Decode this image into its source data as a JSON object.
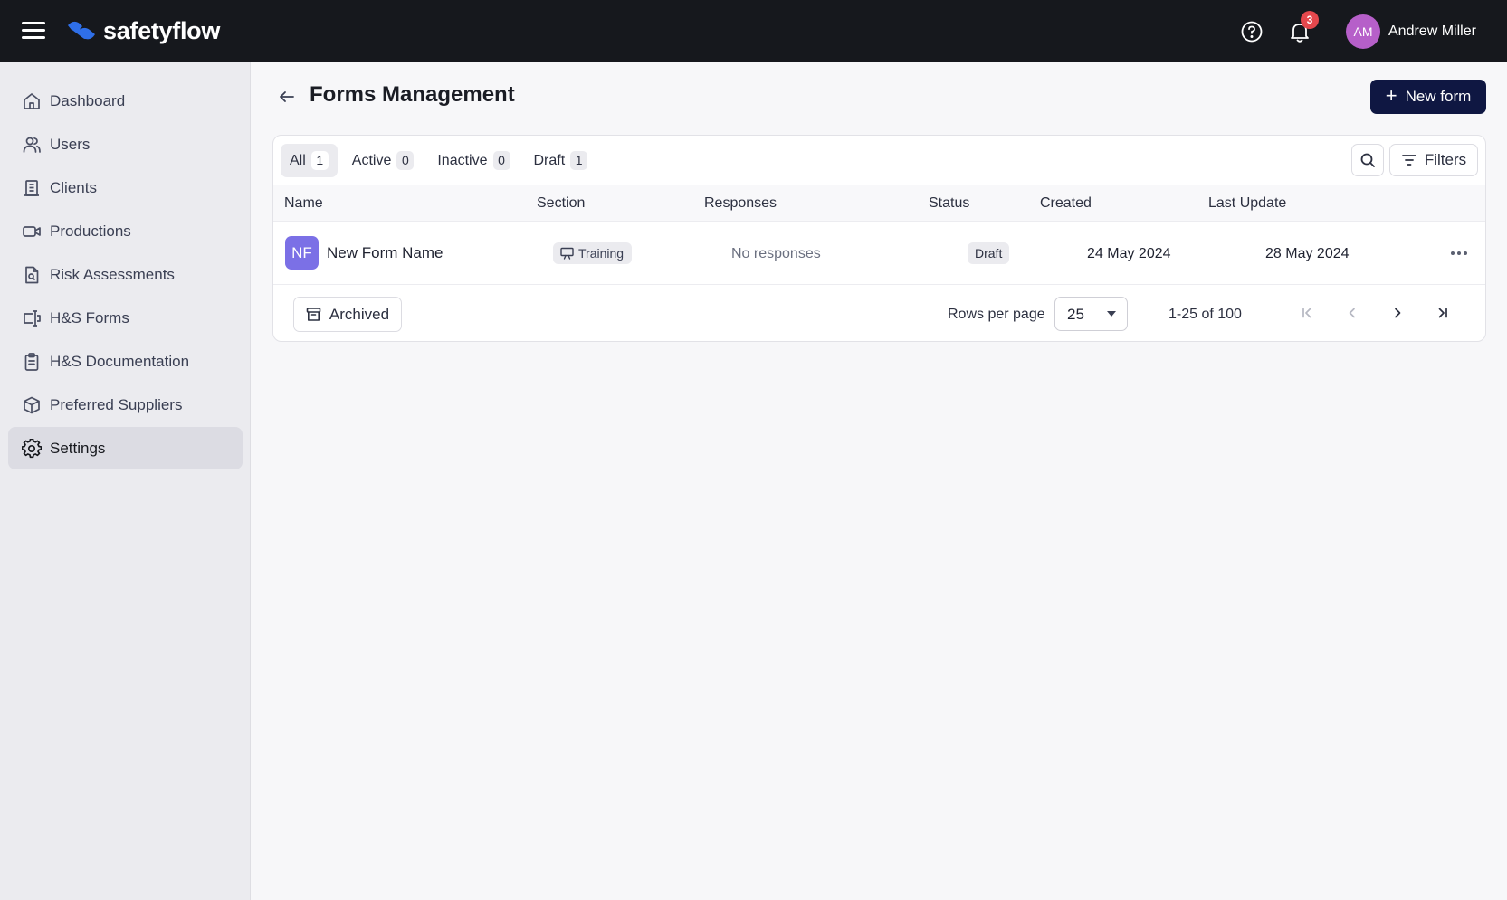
{
  "app": {
    "name": "safetyflow",
    "accent": "#0f1742",
    "brand": "#2f6fe8"
  },
  "topbar": {
    "menu_icon": "hamburger-icon",
    "help_icon": "help-circle-icon",
    "notifications_icon": "bell-icon",
    "notifications_count": "3",
    "user": {
      "initials": "AM",
      "name": "Andrew Miller"
    }
  },
  "sidebar": {
    "items": [
      {
        "label": "Dashboard",
        "icon": "home-icon"
      },
      {
        "label": "Users",
        "icon": "users-icon"
      },
      {
        "label": "Clients",
        "icon": "building-icon"
      },
      {
        "label": "Productions",
        "icon": "video-icon"
      },
      {
        "label": "Risk Assessments",
        "icon": "file-search-icon"
      },
      {
        "label": "H&S Forms",
        "icon": "form-icon"
      },
      {
        "label": "H&S Documentation",
        "icon": "clipboard-icon"
      },
      {
        "label": "Preferred Suppliers",
        "icon": "box-icon"
      },
      {
        "label": "Settings",
        "icon": "gear-icon",
        "active": true
      }
    ]
  },
  "page": {
    "title": "Forms Management",
    "new_button": "New form"
  },
  "tabs": [
    {
      "label": "All",
      "count": "1",
      "active": true
    },
    {
      "label": "Active",
      "count": "0"
    },
    {
      "label": "Inactive",
      "count": "0"
    },
    {
      "label": "Draft",
      "count": "1"
    }
  ],
  "toolbar": {
    "filters_label": "Filters"
  },
  "table": {
    "columns": [
      "Name",
      "Section",
      "Responses",
      "Status",
      "Created",
      "Last Update"
    ],
    "rows": [
      {
        "initials": "NF",
        "name": "New Form Name",
        "section": "Training",
        "responses": "No responses",
        "status": "Draft",
        "created": "24 May 2024",
        "updated": "28 May 2024"
      }
    ]
  },
  "footer": {
    "archived_label": "Archived",
    "rows_per_page_label": "Rows per page",
    "rows_per_page": "25",
    "range": "1-25 of 100"
  }
}
